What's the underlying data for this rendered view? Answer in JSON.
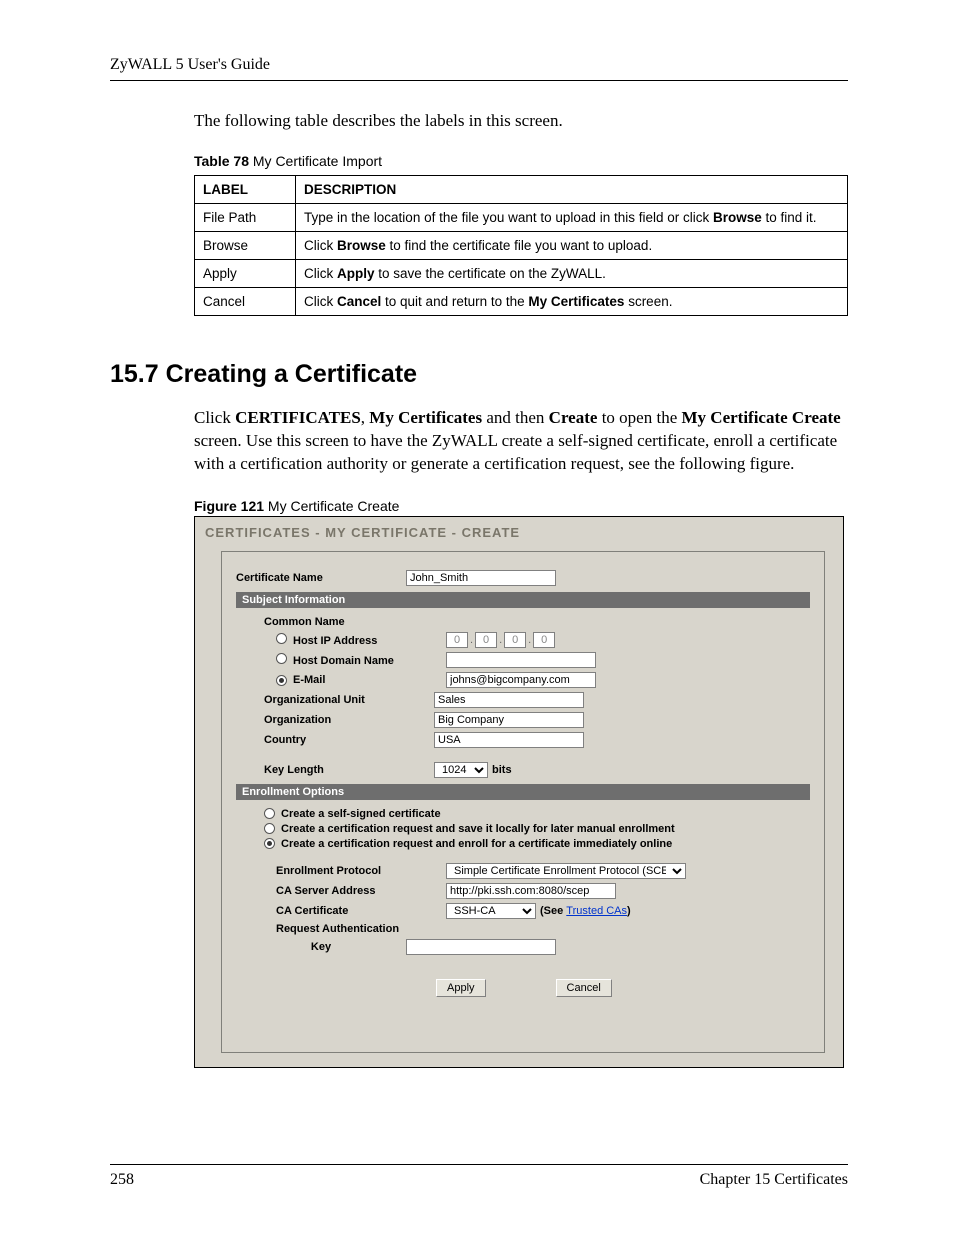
{
  "header": {
    "doc_title": "ZyWALL 5 User's Guide"
  },
  "intro": "The following table describes the labels in this screen.",
  "table78": {
    "caption_bold": "Table 78",
    "caption_rest": "   My Certificate Import",
    "head_label": "LABEL",
    "head_desc": "DESCRIPTION",
    "rows": [
      {
        "label": "File Path",
        "pre": "Type in the location of the file you want to upload in this field or click ",
        "bold": "Browse",
        "post": " to find it."
      },
      {
        "label": "Browse",
        "pre": "Click ",
        "bold": "Browse",
        "post": " to find the certificate file you want to upload."
      },
      {
        "label": "Apply",
        "pre": "Click ",
        "bold": "Apply",
        "post": " to save the certificate on the ZyWALL."
      },
      {
        "label": "Cancel",
        "pre": "Click ",
        "bold": "Cancel",
        "mid": " to quit and return to the ",
        "bold2": "My Certificates",
        "post": " screen."
      }
    ]
  },
  "section": {
    "heading": "15.7  Creating a Certificate",
    "para_parts": {
      "p0": "Click ",
      "b1": "CERTIFICATES",
      "p1": ", ",
      "b2": "My Certificates",
      "p2": " and then ",
      "b3": "Create",
      "p3": " to open the ",
      "b4": "My Certificate Create",
      "p4": " screen. Use this screen to have the ZyWALL create a self-signed certificate, enroll a certificate with a certification authority or generate a certification request, see the following figure."
    }
  },
  "figure": {
    "caption_bold": "Figure 121",
    "caption_rest": "   My Certificate Create",
    "title": "CERTIFICATES - MY CERTIFICATE - CREATE",
    "labels": {
      "cert_name": "Certificate Name",
      "subject_info": "Subject Information",
      "common_name": "Common Name",
      "host_ip": "Host IP Address",
      "host_domain": "Host Domain Name",
      "email": "E-Mail",
      "org_unit": "Organizational Unit",
      "organization": "Organization",
      "country": "Country",
      "key_length": "Key Length",
      "bits": "bits",
      "enroll_options": "Enrollment Options",
      "opt_self": "Create a self-signed certificate",
      "opt_manual": "Create a certification request and save it locally for later manual enrollment",
      "opt_online": "Create a certification request and enroll for a certificate immediately online",
      "enroll_proto": "Enrollment Protocol",
      "ca_server": "CA Server Address",
      "ca_cert": "CA Certificate",
      "see": "(See ",
      "trusted_link": "Trusted CAs",
      "see_close": ")",
      "req_auth": "Request Authentication",
      "key_label": "Key",
      "apply": "Apply",
      "cancel": "Cancel"
    },
    "values": {
      "cert_name": "John_Smith",
      "ip": [
        "0",
        "0",
        "0",
        "0"
      ],
      "domain": "",
      "email": "johns@bigcompany.com",
      "org_unit": "Sales",
      "organization": "Big Company",
      "country": "USA",
      "key_length": "1024",
      "enroll_proto": "Simple Certificate Enrollment Protocol (SCEP)",
      "ca_server": "http://pki.ssh.com:8080/scep",
      "ca_cert": "SSH-CA",
      "key_value": ""
    }
  },
  "footer": {
    "page": "258",
    "chapter": "Chapter 15 Certificates"
  }
}
